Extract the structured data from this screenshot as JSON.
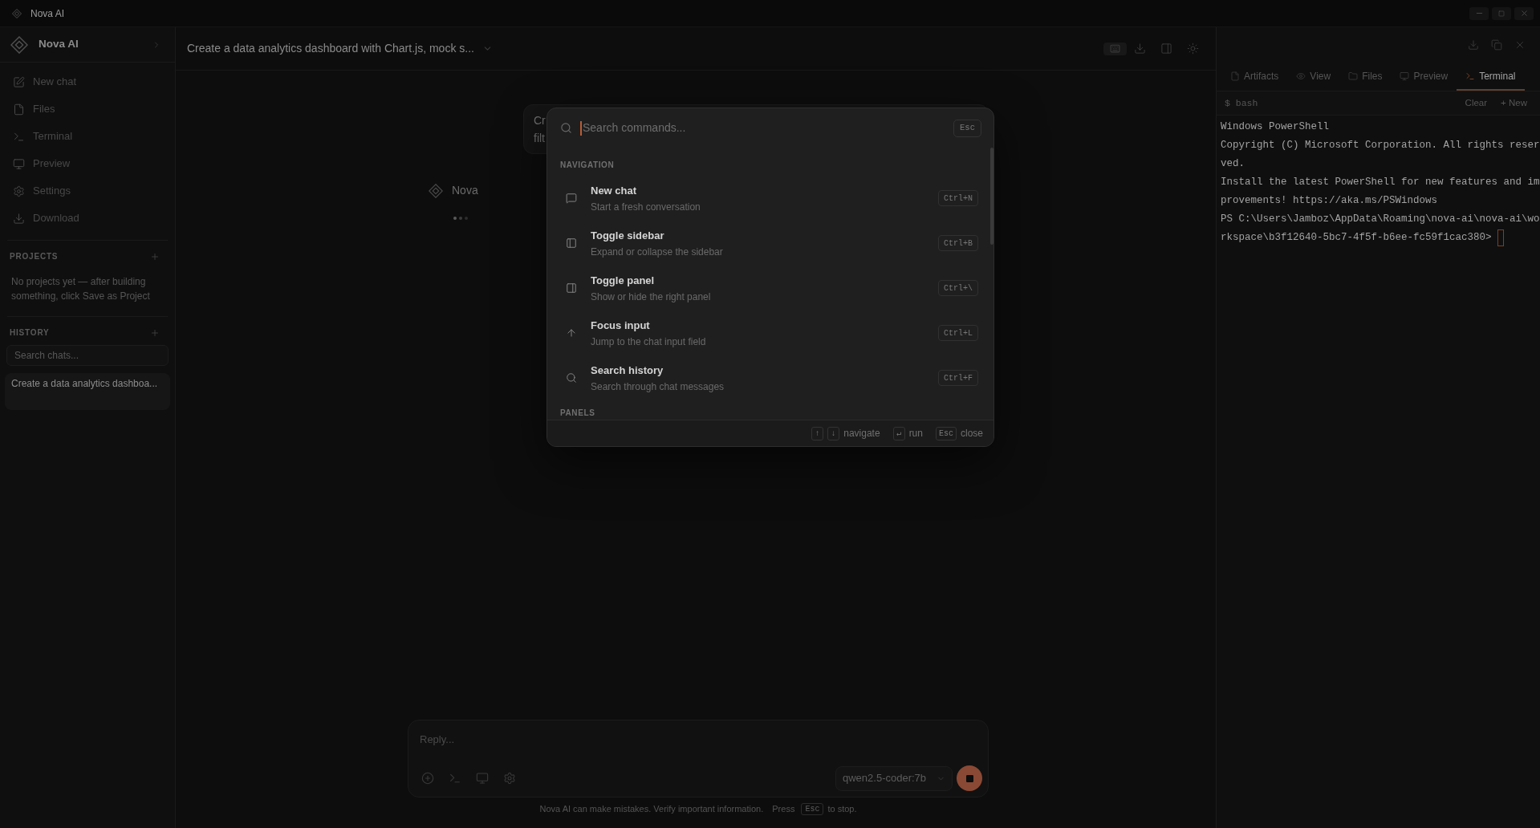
{
  "window": {
    "title": "Nova AI"
  },
  "sidebar": {
    "brand": "Nova AI",
    "nav": [
      "New chat",
      "Files",
      "Terminal",
      "Preview",
      "Settings",
      "Download"
    ],
    "projects": {
      "heading": "PROJECTS",
      "empty_text": "No projects yet — after building something, click Save as Project"
    },
    "history": {
      "heading": "HISTORY",
      "search_placeholder": "Search chats...",
      "items": [
        {
          "title": "Create a data analytics dashboa...",
          "selected": true
        }
      ]
    }
  },
  "header": {
    "title": "Create a data analytics dashboard with Chart.js, mock s..."
  },
  "chat": {
    "user_message": [
      "Cr",
      "filt"
    ],
    "assistant": {
      "name": "Nova",
      "typing": true
    }
  },
  "composer": {
    "placeholder": "Reply...",
    "model": "qwen2.5-coder:7b",
    "generating": true,
    "disclaimer": "Nova AI can make mistakes. Verify important information.",
    "hint": {
      "before": "Press",
      "key": "Esc",
      "after": "to stop."
    }
  },
  "right_panel": {
    "tabs": [
      {
        "label": "Artifacts",
        "selected": false
      },
      {
        "label": "View",
        "selected": false
      },
      {
        "label": "Files",
        "selected": false
      },
      {
        "label": "Preview",
        "selected": false
      },
      {
        "label": "Terminal",
        "selected": true
      }
    ],
    "shell": "$ bash",
    "actions": [
      "Clear",
      "+ New"
    ],
    "terminal_lines": [
      "Windows PowerShell",
      "Copyright (C) Microsoft Corporation. All rights reser",
      "ved.",
      "Install the latest PowerShell for new features and im",
      "provements! https://aka.ms/PSWindows",
      "PS C:\\Users\\Jamboz\\AppData\\Roaming\\nova-ai\\nova-ai\\wo",
      "rkspace\\b3f12640-5bc7-4f5f-b6ee-fc59f1cac380>"
    ]
  },
  "command_palette": {
    "placeholder": "Search commands...",
    "close_key": "Esc",
    "sections": [
      {
        "heading": "NAVIGATION",
        "commands": [
          {
            "title": "New chat",
            "description": "Start a fresh conversation",
            "shortcut": "Ctrl+N"
          },
          {
            "title": "Toggle sidebar",
            "description": "Expand or collapse the sidebar",
            "shortcut": "Ctrl+B"
          },
          {
            "title": "Toggle panel",
            "description": "Show or hide the right panel",
            "shortcut": "Ctrl+\\"
          },
          {
            "title": "Focus input",
            "description": "Jump to the chat input field",
            "shortcut": "Ctrl+L"
          },
          {
            "title": "Search history",
            "description": "Search through chat messages",
            "shortcut": "Ctrl+F"
          }
        ]
      },
      {
        "heading": "PANELS"
      }
    ],
    "footer": [
      {
        "keys": [
          "↑",
          "↓"
        ],
        "label": "navigate"
      },
      {
        "keys": [
          "↵"
        ],
        "label": "run"
      },
      {
        "keys": [
          "Esc"
        ],
        "label": "close"
      }
    ]
  }
}
